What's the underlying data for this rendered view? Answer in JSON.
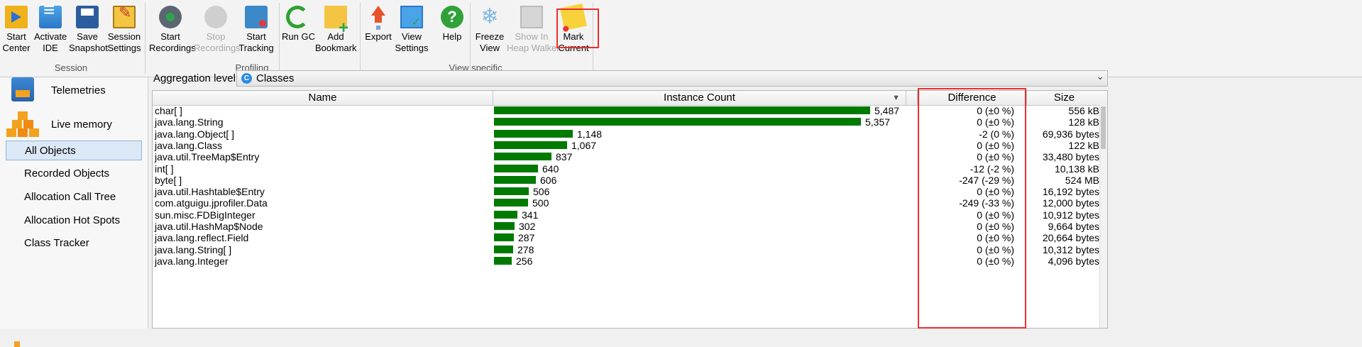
{
  "toolbar": {
    "buttons": [
      {
        "label": "Start\nCenter",
        "icon": "start-center-icon"
      },
      {
        "label": "Activate\nIDE",
        "icon": "activate-ide-icon"
      },
      {
        "label": "Save\nSnapshot",
        "icon": "save-snapshot-icon"
      },
      {
        "label": "Session\nSettings",
        "icon": "session-settings-icon"
      },
      {
        "label": "Start\nRecordings",
        "icon": "start-recordings-icon"
      },
      {
        "label": "Stop\nRecordings",
        "icon": "stop-recordings-icon",
        "disabled": true
      },
      {
        "label": "Start\nTracking",
        "icon": "start-tracking-icon"
      },
      {
        "label": "Run GC",
        "icon": "run-gc-icon"
      },
      {
        "label": "Add\nBookmark",
        "icon": "add-bookmark-icon"
      },
      {
        "label": "Export",
        "icon": "export-icon"
      },
      {
        "label": "View\nSettings",
        "icon": "view-settings-icon"
      },
      {
        "label": "Help",
        "icon": "help-icon"
      },
      {
        "label": "Freeze\nView",
        "icon": "freeze-view-icon"
      },
      {
        "label": "Show In\nHeap Walker",
        "icon": "heap-walker-icon",
        "disabled": true
      },
      {
        "label": "Mark\nCurrent",
        "icon": "mark-current-icon"
      }
    ],
    "groups": {
      "session": "Session",
      "profiling": "Profiling",
      "view_specific": "View specific"
    }
  },
  "sidebar": {
    "sections": [
      {
        "label": "Telemetries",
        "icon": "telemetries-icon"
      },
      {
        "label": "Live memory",
        "icon": "live-memory-icon"
      }
    ],
    "items": [
      {
        "label": "All Objects",
        "selected": true
      },
      {
        "label": "Recorded Objects"
      },
      {
        "label": "Allocation Call Tree"
      },
      {
        "label": "Allocation Hot Spots"
      },
      {
        "label": "Class Tracker"
      }
    ]
  },
  "aggregation": {
    "label": "Aggregation level:",
    "value": "Classes",
    "icon": "class-icon"
  },
  "table": {
    "columns": [
      "Name",
      "Instance Count",
      "Difference",
      "Size"
    ],
    "max_count": 5487,
    "bar_color": "#007a00",
    "rows": [
      {
        "name": "char[ ]",
        "count": 5487,
        "count_text": "5,487",
        "diff": "0 (±0 %)",
        "size": "556 kB"
      },
      {
        "name": "java.lang.String",
        "count": 5357,
        "count_text": "5,357",
        "diff": "0 (±0 %)",
        "size": "128 kB"
      },
      {
        "name": "java.lang.Object[ ]",
        "count": 1148,
        "count_text": "1,148",
        "diff": "-2 (0 %)",
        "size": "69,936 bytes"
      },
      {
        "name": "java.lang.Class",
        "count": 1067,
        "count_text": "1,067",
        "diff": "0 (±0 %)",
        "size": "122 kB"
      },
      {
        "name": "java.util.TreeMap$Entry",
        "count": 837,
        "count_text": "837",
        "diff": "0 (±0 %)",
        "size": "33,480 bytes"
      },
      {
        "name": "int[ ]",
        "count": 640,
        "count_text": "640",
        "diff": "-12 (-2 %)",
        "size": "10,138 kB"
      },
      {
        "name": "byte[ ]",
        "count": 606,
        "count_text": "606",
        "diff": "-247 (-29 %)",
        "size": "524 MB"
      },
      {
        "name": "java.util.Hashtable$Entry",
        "count": 506,
        "count_text": "506",
        "diff": "0 (±0 %)",
        "size": "16,192 bytes"
      },
      {
        "name": "com.atguigu.jprofiler.Data",
        "count": 500,
        "count_text": "500",
        "diff": "-249 (-33 %)",
        "size": "12,000 bytes"
      },
      {
        "name": "sun.misc.FDBigInteger",
        "count": 341,
        "count_text": "341",
        "diff": "0 (±0 %)",
        "size": "10,912 bytes"
      },
      {
        "name": "java.util.HashMap$Node",
        "count": 302,
        "count_text": "302",
        "diff": "0 (±0 %)",
        "size": "9,664 bytes"
      },
      {
        "name": "java.lang.reflect.Field",
        "count": 287,
        "count_text": "287",
        "diff": "0 (±0 %)",
        "size": "20,664 bytes"
      },
      {
        "name": "java.lang.String[ ]",
        "count": 278,
        "count_text": "278",
        "diff": "0 (±0 %)",
        "size": "10,312 bytes"
      },
      {
        "name": "java.lang.Integer",
        "count": 256,
        "count_text": "256",
        "diff": "0 (±0 %)",
        "size": "4,096 bytes"
      }
    ]
  }
}
